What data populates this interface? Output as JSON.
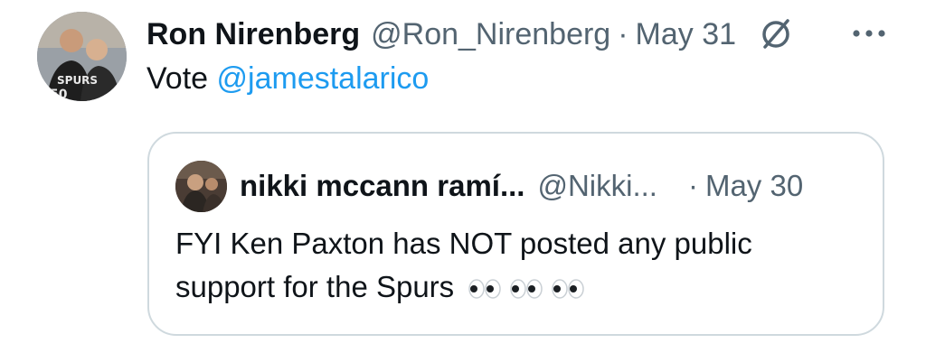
{
  "tweet": {
    "author_name": "Ron Nirenberg",
    "author_handle": "@Ron_Nirenberg",
    "separator": "·",
    "date": "May 31",
    "text_prefix": "Vote ",
    "mention": "@jamestalarico",
    "status_icon": "no-sign-icon",
    "more_icon": "more-dots-icon"
  },
  "quote": {
    "author_name": "nikki mccann ramí...",
    "author_handle": "@Nikki...",
    "separator": "·",
    "date": "May 30",
    "text_line1": "FYI Ken Paxton has NOT posted any public",
    "text_line2": "support for the Spurs",
    "emoji": [
      "eyes-emoji",
      "eyes-emoji",
      "eyes-emoji"
    ]
  },
  "colors": {
    "text": "#0f1419",
    "secondary": "#536471",
    "link": "#1d9bf0",
    "border": "#cfd9de"
  }
}
